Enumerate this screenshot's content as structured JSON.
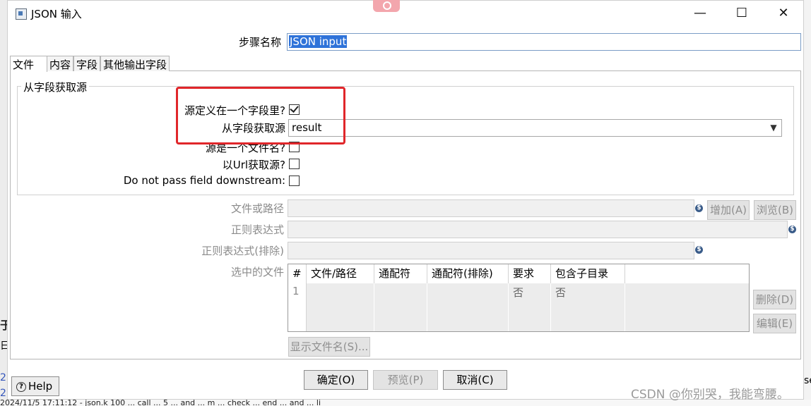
{
  "window": {
    "title": "JSON 输入",
    "minimize": "—",
    "maximize": "☐",
    "close": "✕"
  },
  "step_name": {
    "label": "步骤名称",
    "value": "JSON input"
  },
  "tabs": [
    {
      "label": "文件",
      "active": true
    },
    {
      "label": "内容",
      "active": false
    },
    {
      "label": "字段",
      "active": false
    },
    {
      "label": "其他输出字段",
      "active": false
    }
  ],
  "group": {
    "title": "从字段获取源",
    "source_in_field_label": "源定义在一个字段里?",
    "source_in_field_checked": true,
    "source_field_label": "从字段获取源",
    "source_field_value": "result",
    "source_is_filename_label": "源是一个文件名?",
    "source_is_filename_checked": false,
    "read_url_label": "以Url获取源?",
    "read_url_checked": false,
    "do_not_pass_label": "Do not pass field downstream:",
    "do_not_pass_checked": false
  },
  "file_section": {
    "file_or_dir_label": "文件或路径",
    "regex_label": "正则表达式",
    "regex_exclude_label": "正则表达式(排除)",
    "selected_files_label": "选中的文件",
    "add_button": "增加(A)",
    "browse_button": "浏览(B)",
    "delete_button": "删除(D)",
    "edit_button": "编辑(E)",
    "show_filenames_button": "显示文件名(S)...",
    "variable_icon": "$"
  },
  "table": {
    "columns": [
      "#",
      "文件/路径",
      "通配符",
      "通配符(排除)",
      "要求",
      "包含子目录"
    ],
    "rows": [
      {
        "num": "1",
        "path": "",
        "wildcard": "",
        "wildcard_exclude": "",
        "required": "否",
        "include_subfolders": "否"
      }
    ]
  },
  "buttons": {
    "ok": "确定(O)",
    "preview": "预览(P)",
    "cancel": "取消(C)",
    "help": "Help"
  },
  "watermark": "CSDN @你别哭，我能弯腰。",
  "background_window": {
    "glyph_1": "于",
    "glyph_2": "日",
    "link_1": "2",
    "link_2": "2",
    "right_fragment": "se",
    "bottom_text": "2024/11/5 17:11:12 - json.k 100 ... call ... 5 ... and ... m ... check ... end ... and ... li"
  },
  "colors": {
    "selection": "#2f73d9",
    "highlight_box": "#e0262a",
    "disabled_text": "#8f8f8f"
  }
}
